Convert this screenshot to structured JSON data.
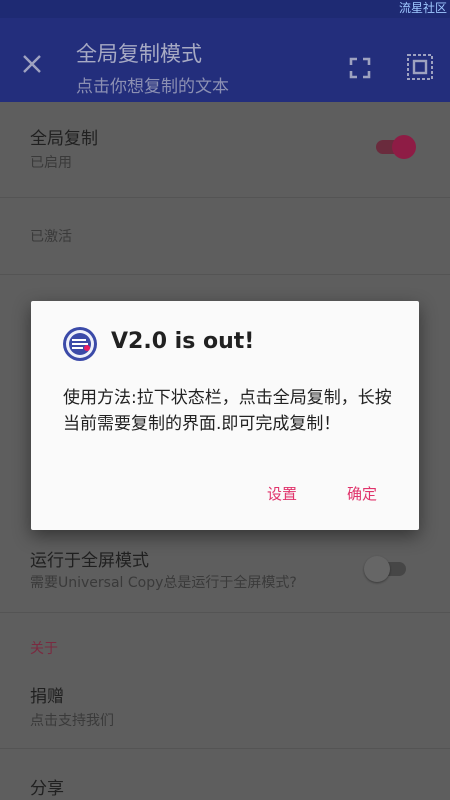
{
  "statusbar": {
    "watermark": "流星社区"
  },
  "toolbar": {
    "title": "全局复制模式",
    "subtitle": "点击你想复制的文本",
    "close_icon": "close-icon",
    "fullscreen_icon": "fullscreen-icon",
    "select_icon": "select-all-icon"
  },
  "settings": {
    "global_copy": {
      "title": "全局复制",
      "subtitle": "已启用",
      "enabled": true
    },
    "activated": {
      "label": "已激活"
    },
    "fullscreen": {
      "title": "运行于全屏模式",
      "subtitle": "需要Universal Copy总是运行于全屏模式?",
      "enabled": false
    },
    "about_header": "关于",
    "donate": {
      "title": "捐赠",
      "subtitle": "点击支持我们"
    },
    "share": {
      "title": "分享"
    }
  },
  "dialog": {
    "title": "V2.0 is out!",
    "message": "使用方法:拉下状态栏，点击全局复制，长按当前需要复制的界面.即可完成复制！",
    "settings_button": "设置",
    "ok_button": "确定"
  },
  "colors": {
    "primary": "#3F51B5",
    "primary_dark": "#303F9F",
    "accent": "#E91E63",
    "dialog_button": "#E0336B"
  }
}
